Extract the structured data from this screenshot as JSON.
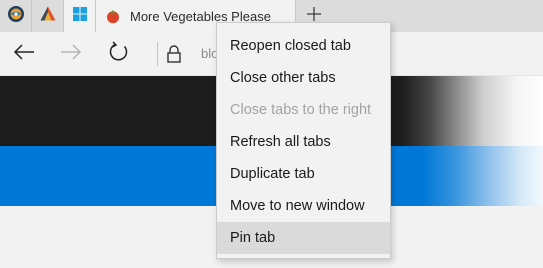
{
  "tabs": {
    "pinned": [
      {
        "icon": "compass-app-icon"
      },
      {
        "icon": "triangle-logo-icon"
      },
      {
        "icon": "windows-logo-icon"
      }
    ],
    "active": {
      "title": "More Vegetables Please",
      "icon": "tomato-icon"
    },
    "new_tab_label": "+"
  },
  "toolbar": {
    "back_icon": "back-arrow-icon",
    "forward_icon": "forward-arrow-icon",
    "refresh_icon": "refresh-icon",
    "lock_icon": "lock-icon",
    "address_text": "blo"
  },
  "context_menu": {
    "items": [
      {
        "label": "Reopen closed tab",
        "enabled": true
      },
      {
        "label": "Close other tabs",
        "enabled": true
      },
      {
        "label": "Close tabs to the right",
        "enabled": false
      },
      {
        "label": "Refresh all tabs",
        "enabled": true
      },
      {
        "label": "Duplicate tab",
        "enabled": true
      },
      {
        "label": "Move to new window",
        "enabled": true
      },
      {
        "label": "Pin tab",
        "enabled": true,
        "hovered": true
      }
    ]
  },
  "colors": {
    "accent_blue": "#0078d7",
    "content_black": "#1c1c1c",
    "tabstrip_bg": "#dcdcdc",
    "toolbar_bg": "#f2f2f2",
    "menu_hover": "#dadada",
    "menu_disabled_text": "#a3a3a3"
  }
}
